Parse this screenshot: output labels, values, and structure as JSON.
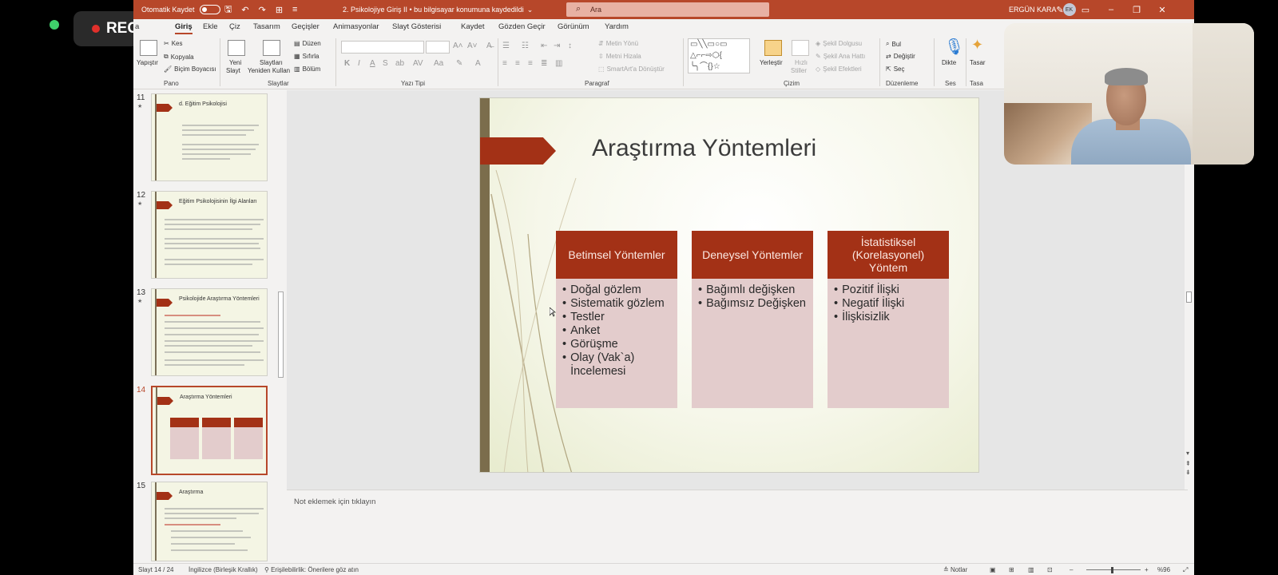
{
  "overlay": {
    "rec_label": "REC"
  },
  "titlebar": {
    "autosave_label": "Otomatik Kaydet",
    "document_title": "2. Psikolojiye Giriş II  •  bu bilgisayar konumuna kaydedildi",
    "search_placeholder": "Ara",
    "user_name": "ERGÜN KARA",
    "user_initials": "EK"
  },
  "tabs": [
    "Giriş",
    "Ekle",
    "Çiz",
    "Tasarım",
    "Geçişler",
    "Animasyonlar",
    "Slayt Gösterisi",
    "Kaydet",
    "Gözden Geçir",
    "Görünüm",
    "Yardım"
  ],
  "active_tab": "Giriş",
  "ribbon": {
    "pano": {
      "label": "Pano",
      "paste": "Yapıştır",
      "cut": "Kes",
      "copy": "Kopyala",
      "format_painter": "Biçim Boyacısı"
    },
    "slaytlar": {
      "label": "Slaytlar",
      "new_slide_1": "Yeni",
      "new_slide_2": "Slayt",
      "reuse_1": "Slaytları",
      "reuse_2": "Yeniden Kullan",
      "layout": "Düzen",
      "reset": "Sıfırla",
      "section": "Bölüm"
    },
    "yazi_tipi": {
      "label": "Yazı Tipi"
    },
    "paragraf": {
      "label": "Paragraf",
      "text_direction": "Metin Yönü",
      "align_text": "Metni Hizala",
      "smartart": "SmartArt'a Dönüştür"
    },
    "cizim": {
      "label": "Çizim",
      "arrange": "Yerleştir",
      "quick_styles_1": "Hızlı",
      "quick_styles_2": "Stiller",
      "shape_fill": "Şekil Dolgusu",
      "shape_outline": "Şekil Ana Hattı",
      "shape_effects": "Şekil Efektleri"
    },
    "duzenleme": {
      "label": "Düzenleme",
      "find": "Bul",
      "replace": "Değiştir",
      "select": "Seç"
    },
    "ses": {
      "label": "Ses",
      "dictate": "Dikte"
    },
    "tasarimci": {
      "label": "Tasa",
      "button": "Tasar"
    }
  },
  "thumbnails": [
    {
      "num": "11",
      "title": "d. Eğitim Psikolojisi"
    },
    {
      "num": "12",
      "title": "Eğitim Psikolojisinin İlgi Alanları"
    },
    {
      "num": "13",
      "title": "Psikolojide Araştırma Yöntemleri"
    },
    {
      "num": "14",
      "title": "Araştırma Yöntemleri"
    },
    {
      "num": "15",
      "title": "Araştırma"
    }
  ],
  "slide": {
    "title": "Araştırma Yöntemleri",
    "columns": [
      {
        "header": "Betimsel Yöntemler",
        "items": [
          "Doğal gözlem",
          "Sistematik gözlem",
          "Testler",
          "Anket",
          "Görüşme",
          "Olay (Vak`a) İncelemesi"
        ]
      },
      {
        "header": "Deneysel Yöntemler",
        "items": [
          "Bağımlı değişken",
          "Bağımsız Değişken"
        ]
      },
      {
        "header": "İstatistiksel (Korelasyonel) Yöntem",
        "items": [
          "Pozitif İlişki",
          "Negatif İlişki",
          "İlişkisizlik"
        ]
      }
    ]
  },
  "notes_placeholder": "Not eklemek için tıklayın",
  "status": {
    "slide_counter": "Slayt 14 / 24",
    "language": "İngilizce (Birleşik Krallık)",
    "accessibility": "Erişilebilirlik: Önerilere göz atın",
    "notes_button": "Notlar",
    "zoom": "%96"
  }
}
